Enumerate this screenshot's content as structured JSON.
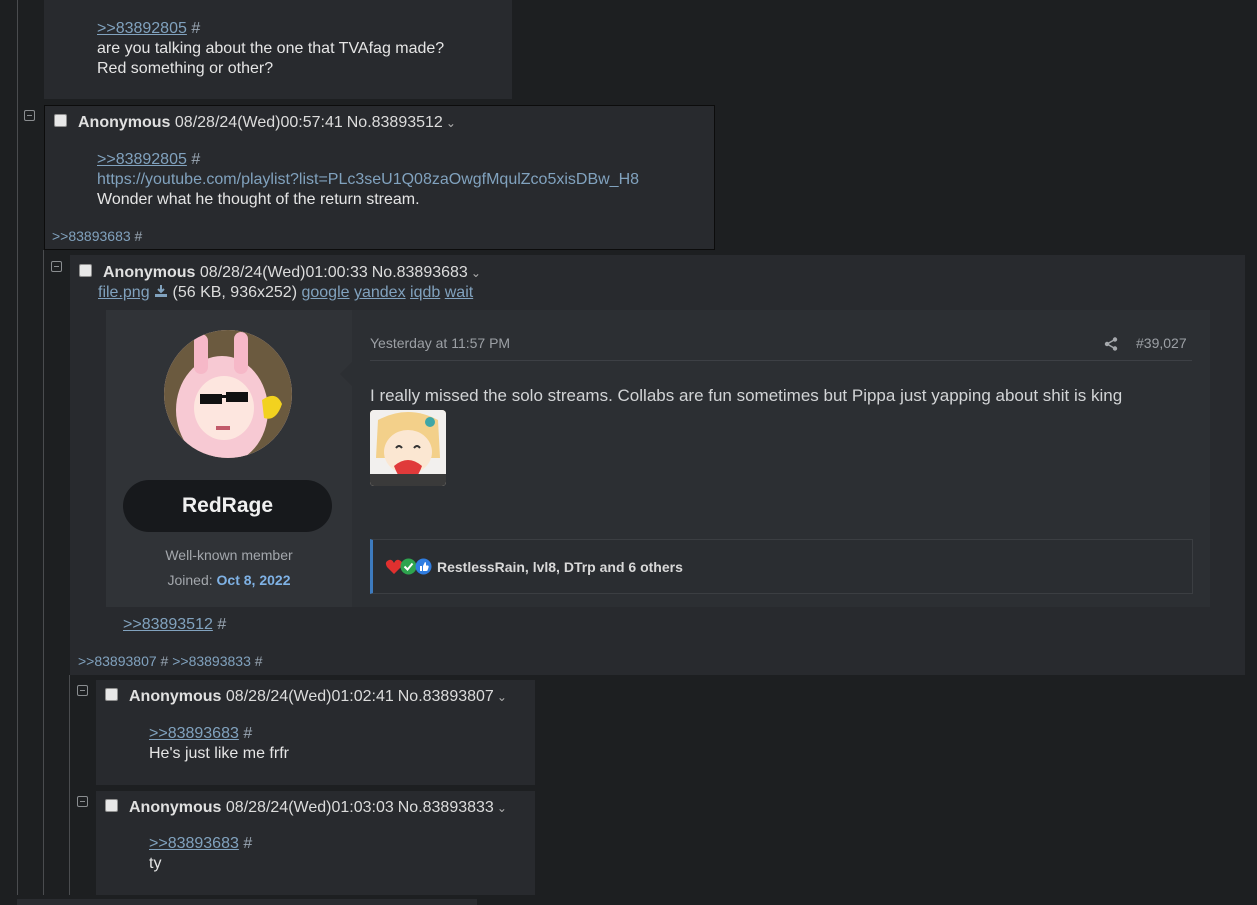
{
  "post0": {
    "quote": ">>83892805",
    "hash": "#",
    "line1": "are you talking about the one that TVAfag made?",
    "line2": "Red something or other?"
  },
  "post1": {
    "name": "Anonymous",
    "datetime": "08/28/24(Wed)00:57:41",
    "number": "No.83893512",
    "quote": ">>83892805",
    "hash": "#",
    "url": "https://youtube.com/playlist?list=PLc3seU1Q08zaOwgfMqulZco5xisDBw_H8",
    "body": "Wonder what he thought of the return stream.",
    "backlink": ">>83893683",
    "backlink_hash": "#"
  },
  "post2": {
    "name": "Anonymous",
    "datetime": "08/28/24(Wed)01:00:33",
    "number": "No.83893683",
    "file_name": "file.png",
    "file_info": "(56 KB, 936x252)",
    "search_links": [
      "google",
      "yandex",
      "iqdb",
      "wait"
    ],
    "quote": ">>83893512",
    "hash": "#",
    "backlinks": [
      ">>83893807",
      ">>83893833"
    ],
    "backlink_hash": "#",
    "embed": {
      "username": "RedRage",
      "user_title": "Well-known member",
      "joined_label": "Joined:",
      "joined_date": "Oct 8, 2022",
      "timestamp": "Yesterday at 11:57 PM",
      "post_number": "#39,027",
      "message": "I really missed the solo streams. Collabs are fun sometimes but Pippa just yapping about shit is king",
      "reactions": "RestlessRain, lvl8, DTrp and 6 others"
    }
  },
  "post3": {
    "name": "Anonymous",
    "datetime": "08/28/24(Wed)01:02:41",
    "number": "No.83893807",
    "quote": ">>83893683",
    "hash": "#",
    "body": "He's just like me frfr"
  },
  "post4": {
    "name": "Anonymous",
    "datetime": "08/28/24(Wed)01:03:03",
    "number": "No.83893833",
    "quote": ">>83893683",
    "hash": "#",
    "body": "ty"
  },
  "colors": {
    "background": "#1d1f21",
    "post": "#282a2e",
    "link": "#81a2be",
    "reaction_accent": "#3d7bbf"
  },
  "icons": [
    "minus-icon",
    "checkbox",
    "chevron-down-icon",
    "download-icon",
    "share-icon",
    "heart-icon",
    "check-icon",
    "thumbs-up-icon"
  ]
}
